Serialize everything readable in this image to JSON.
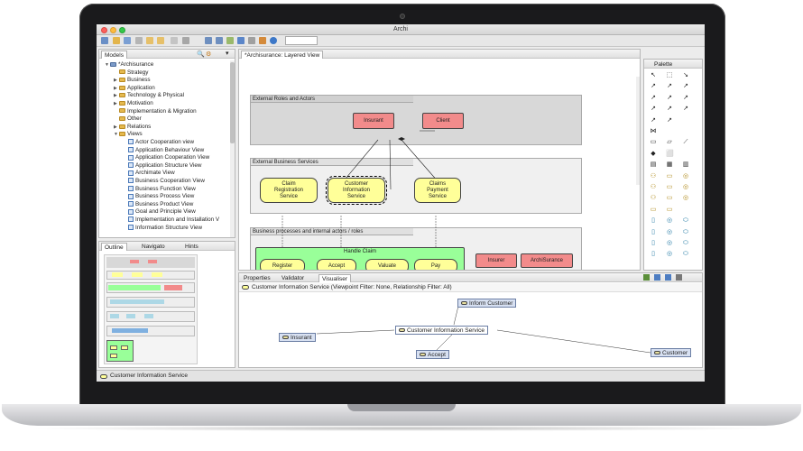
{
  "window": {
    "title": "Archi"
  },
  "models": {
    "tab_label": "Models",
    "items": [
      {
        "label": "*Archisurance",
        "depth": 0,
        "kind": "root",
        "expand": "▼"
      },
      {
        "label": "Strategy",
        "depth": 1,
        "kind": "folder",
        "expand": ""
      },
      {
        "label": "Business",
        "depth": 1,
        "kind": "folder",
        "expand": "▶"
      },
      {
        "label": "Application",
        "depth": 1,
        "kind": "folder",
        "expand": "▶"
      },
      {
        "label": "Technology & Physical",
        "depth": 1,
        "kind": "folder",
        "expand": "▶"
      },
      {
        "label": "Motivation",
        "depth": 1,
        "kind": "folder",
        "expand": "▶"
      },
      {
        "label": "Implementation & Migration",
        "depth": 1,
        "kind": "folder",
        "expand": ""
      },
      {
        "label": "Other",
        "depth": 1,
        "kind": "folder",
        "expand": ""
      },
      {
        "label": "Relations",
        "depth": 1,
        "kind": "folder",
        "expand": "▶"
      },
      {
        "label": "Views",
        "depth": 1,
        "kind": "folder",
        "expand": "▼"
      },
      {
        "label": "Actor Cooperation view",
        "depth": 2,
        "kind": "view",
        "expand": ""
      },
      {
        "label": "Application Behaviour View",
        "depth": 2,
        "kind": "view",
        "expand": ""
      },
      {
        "label": "Application Cooperation View",
        "depth": 2,
        "kind": "view",
        "expand": ""
      },
      {
        "label": "Application Structure View",
        "depth": 2,
        "kind": "view",
        "expand": ""
      },
      {
        "label": "Archimate View",
        "depth": 2,
        "kind": "view",
        "expand": ""
      },
      {
        "label": "Business Cooperation View",
        "depth": 2,
        "kind": "view",
        "expand": ""
      },
      {
        "label": "Business Function View",
        "depth": 2,
        "kind": "view",
        "expand": ""
      },
      {
        "label": "Business Process View",
        "depth": 2,
        "kind": "view",
        "expand": ""
      },
      {
        "label": "Business Product View",
        "depth": 2,
        "kind": "view",
        "expand": ""
      },
      {
        "label": "Goal and Principle View",
        "depth": 2,
        "kind": "view",
        "expand": ""
      },
      {
        "label": "Implementation and Installation V",
        "depth": 2,
        "kind": "view",
        "expand": ""
      },
      {
        "label": "Information Structure View",
        "depth": 2,
        "kind": "view",
        "expand": ""
      }
    ]
  },
  "outline": {
    "tabs": [
      "Outline",
      "Navigato",
      "Hints"
    ]
  },
  "editor": {
    "tab_label": "*Archisurance: Layered View",
    "groups": [
      {
        "title": "External Roles and Actors"
      },
      {
        "title": "External Business Services"
      },
      {
        "title": "Business processes and internal actors / roles"
      }
    ],
    "elements": {
      "insurant": "Insurant",
      "client": "Client",
      "claim_reg": "Claim Registration Service",
      "cust_info": "Customer Information Service",
      "claims_pay": "Claims Payment Service",
      "handle_claim": "Handle Claim",
      "register": "Register",
      "accept": "Accept",
      "valuate": "Valuate",
      "pay": "Pay",
      "insurer": "Insurer",
      "archisurance": "ArchiSurance"
    }
  },
  "palette": {
    "title": "Palette"
  },
  "bottom": {
    "tabs": [
      "Properties",
      "Validator",
      "Visualiser"
    ],
    "header": "Customer Information Service (Viewpoint Filter: None, Relationship Filter: All)",
    "nodes": {
      "inform": "Inform Customer",
      "center": "Customer Information Service",
      "insurant": "Insurant",
      "accept": "Accept",
      "customer": "Customer"
    }
  },
  "status": {
    "text": "Customer Information Service"
  },
  "colors": {
    "actor": "#f28b8b",
    "service": "#ffff99",
    "process": "#99ff99",
    "group": "#d8d8d8"
  }
}
